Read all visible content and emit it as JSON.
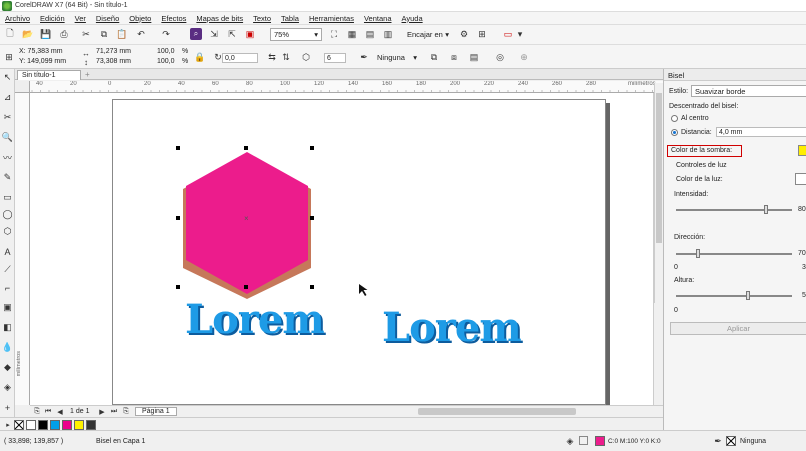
{
  "window": {
    "title": "CorelDRAW X7 (64 Bit) - Sin título-1"
  },
  "menu": [
    "Archivo",
    "Edición",
    "Ver",
    "Diseño",
    "Objeto",
    "Efectos",
    "Mapas de bits",
    "Texto",
    "Tabla",
    "Herramientas",
    "Ventana",
    "Ayuda"
  ],
  "toolbar": {
    "zoom": "75%",
    "snap": "Encajar en"
  },
  "propbar": {
    "x": "X: 75,383 mm",
    "y": "Y: 149,099 mm",
    "w": "71,273 mm",
    "h": "73,308 mm",
    "sx": "100,0",
    "sy": "100,0",
    "pct1": "%",
    "pct2": "%",
    "angle": "0,0",
    "sides": "6",
    "outline": "Ninguna"
  },
  "tabs": {
    "doc": "Sin título-1"
  },
  "rulers": {
    "unit": "milímetros",
    "h": [
      "40",
      "20",
      "0",
      "20",
      "40",
      "60",
      "80",
      "100",
      "120",
      "140",
      "160",
      "180",
      "200",
      "220",
      "240",
      "260",
      "280"
    ]
  },
  "page_nav": {
    "count": "1 de 1",
    "page": "Página 1"
  },
  "canvas": {
    "lorem1": "Lorem",
    "lorem2": "Lorem",
    "hex_fill": "#ec1c8c",
    "hex_shadow": "#c6785a",
    "text_color": "#1e9be6"
  },
  "status": {
    "coords": "( 33,898; 139,857 )",
    "layer": "Bisel en Capa 1",
    "fill": "C:0 M:100 Y:0 K:0",
    "outline": "Ninguna"
  },
  "palette": [
    "#ffffff",
    "#000000",
    "#00a0e9",
    "#ec008c",
    "#fff200",
    "#333333"
  ],
  "docker": {
    "title": "Bisel",
    "estilo_label": "Estilo:",
    "estilo": "Suavizar borde",
    "offset_label": "Descentrado del bisel:",
    "al_centro": "Al centro",
    "distancia": "Distancia:",
    "distancia_val": "4,0 mm",
    "shadow_color": "Color de la sombra:",
    "light_controls": "Controles de luz",
    "light_color": "Color de la luz:",
    "intensidad": "Intensidad:",
    "intensidad_val": "80",
    "direccion": "Dirección:",
    "direccion_val": "70",
    "direccion_min": "0",
    "direccion_max": "3",
    "altura": "Altura:",
    "altura_val": "5",
    "altura_min": "0",
    "aplicar": "Aplicar"
  }
}
